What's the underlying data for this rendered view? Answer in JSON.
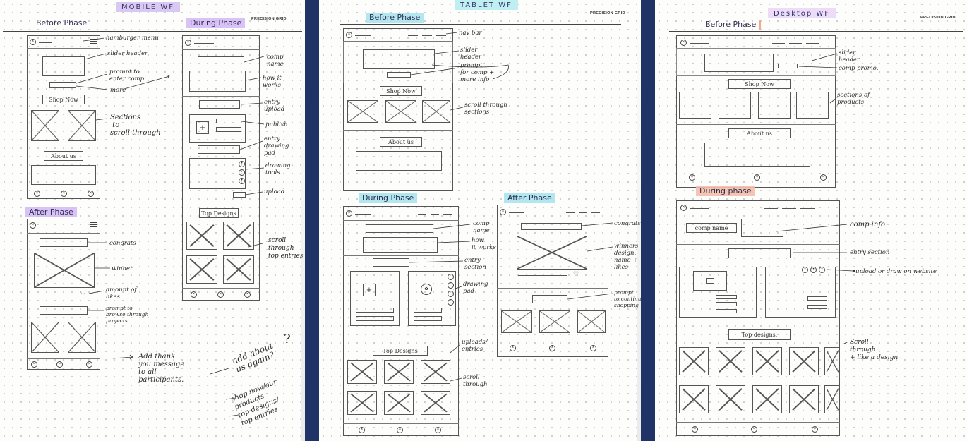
{
  "colors": {
    "frame": "#1f3366",
    "paper": "#fdfdfb",
    "ink": "#333333",
    "highlight_purple": "#d8c8f2",
    "highlight_teal": "#bfeff0",
    "highlight_salmon": "#f5beaa"
  },
  "icons": {
    "placeholder": "x-in-circle-icon",
    "menu": "hamburger-icon",
    "nav": "x-in-circle-icon"
  },
  "mobile": {
    "title": "MOBILE WF",
    "brand": "PRECISION GRID",
    "before_label": "Before Phase",
    "during_label": "During Phase",
    "after_label": "After Phase",
    "shop_now": "Shop Now",
    "about_us": "About us",
    "top_designs": "Top Designs",
    "notes": {
      "hamburger": "hamburger menu",
      "slider": "slider header",
      "prompt_enter": "prompt to\nenter comp",
      "more": "more",
      "sections": "Sections\n to\nscroll through",
      "comp_name": "comp\nname",
      "how_it_works": "how it\nworks",
      "entry_upload": "entry\nupload",
      "publish": "publish",
      "entry_pad": "entry\ndrawing\npad",
      "drawing_tools": "drawing\ntools",
      "upload": "upload",
      "scroll_top": "scroll\nthrough\ntop entries",
      "congrats": "congrats",
      "winner": "winner",
      "amount_likes": "amount of\nlikes",
      "prompt_browse": "prompt to\nbrowse through\nprojects",
      "thank_you": "Add thank\nyou message\nto all\nparticipants.",
      "add_about": "add about\nus again?",
      "shop_products": "shop now/our\nproducts",
      "top_entries": "top designs/\ntop entries"
    }
  },
  "tablet": {
    "title": "TABLET WF",
    "brand": "PRECISION GRID",
    "before_label": "Before Phase",
    "during_label": "During Phase",
    "after_label": "After Phase",
    "shop_now": "Shop Now",
    "about_us": "About us",
    "top_designs": "Top Designs",
    "notes": {
      "nav_bar": "nav bar",
      "slider": "slider\nheader",
      "prompt_comp": "prompt\nfor comp +\nmore info",
      "scroll_sections": "scroll through\nsections",
      "comp_name": "comp\nname",
      "how_it_works": "how\nit works",
      "entry_section": "entry\nsection",
      "drawing_pad": "drawing\npad",
      "uploads_entries": "uploads/\nentries",
      "scroll_through": "scroll\nthrough",
      "congrats": "congrats",
      "winners_design": "winners\ndesign,\nname +\nlikes",
      "prompt_continue": "prompt\nto continue\nshopping"
    }
  },
  "desktop": {
    "title": "Desktop WF",
    "brand": "PRECISION GRID",
    "before_label": "Before Phase",
    "during_label": "During phase",
    "shop_now": "Shop Now",
    "about_us": "About us",
    "top_designs": "Top designs.",
    "comp_name": "comp name",
    "notes": {
      "slider": "slider\nheader",
      "comp_promo": "comp promo.",
      "sections_products": "sections of\nproducts",
      "comp_info": "comp info",
      "entry_section": "entry section",
      "upload_draw": "upload or draw on website",
      "scroll_like": "Scroll\nthrough\n+ like a design"
    }
  }
}
